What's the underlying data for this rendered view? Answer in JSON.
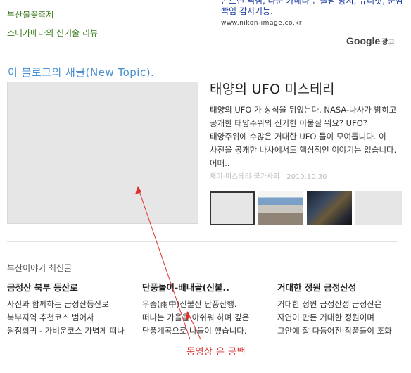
{
  "ads": {
    "left_links": [
      "부산불꽃축제",
      "소니카메라의 신기술 리뷰"
    ],
    "right_text": "콘트런 액침, 다운 카메라 은들림 방지, 뉴리찻, 눈깜빡임 감지기능.",
    "right_url": "www.nikon-image.co.kr",
    "google_label_brand": "Google",
    "google_label_ad": "광고"
  },
  "section": {
    "title": "이 블로그의 새글(New Topic)."
  },
  "featured": {
    "title": "태양의 UFO 미스테리",
    "body": "태양의 UFO 가 상식을 뒤었는다. NASA-나사가 밝히고 공개한 태양주위의 신기한 이물질 뭐요? UFO? 태양주위에 수많은 거대한 UFO 들이 모여듭니다. 이 사진을 공개한 나사에서도 핵심적인 이야기는 없습니다. 어떠..",
    "category": "재미-미스테리-불가사의",
    "date": "2010.10.30"
  },
  "news": {
    "heading": "부산이야기 최신글",
    "items": [
      {
        "title": "금정산 북부 등산로",
        "body": "사진과 함께하는 금정산등산로 북부지역 추천코스 범어사 원점회귀 - 가벼운코스 가볍게 떠나"
      },
      {
        "title": "단풍놀이-배내골(신불..",
        "body": "우중(雨中)신불산 단풍산행. 떠나는 가을을 아쉬워 하며 깊은 단풍계곡으로 나들이 했습니다."
      },
      {
        "title": "거대한 정원 금정산성",
        "body": "거대한 정원 금정산성 금정산은 자연이 만든 거대한 정원이며 그안에 잘 다듬어진 작품들이 조화"
      }
    ]
  },
  "annotation": {
    "text": "동영상 은 공백",
    "color": "#e03030"
  }
}
